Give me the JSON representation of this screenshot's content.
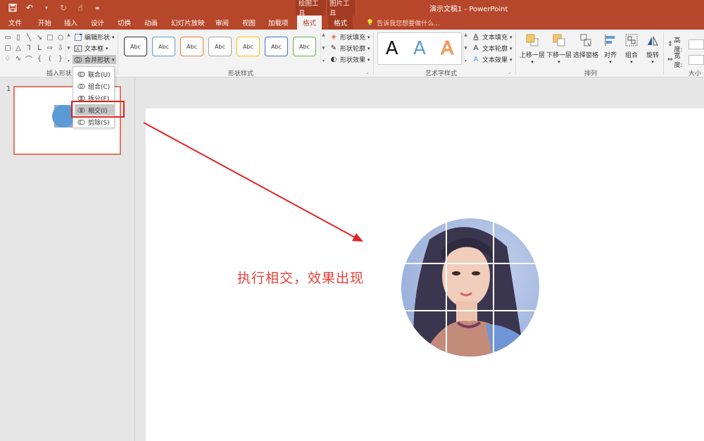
{
  "app": {
    "window_title": "演示文稿1 - PowerPoint",
    "context_groups": [
      "绘图工具",
      "图片工具"
    ]
  },
  "tabs": [
    {
      "label": "文件"
    },
    {
      "label": "开始"
    },
    {
      "label": "插入"
    },
    {
      "label": "设计"
    },
    {
      "label": "切换"
    },
    {
      "label": "动画"
    },
    {
      "label": "幻灯片放映"
    },
    {
      "label": "审阅"
    },
    {
      "label": "视图"
    },
    {
      "label": "加载项"
    },
    {
      "label": "格式"
    },
    {
      "label": "格式"
    }
  ],
  "tell_me": "告诉我您想要做什么...",
  "ribbon": {
    "insert_shapes": {
      "label": "插入形状",
      "edit_shape": "编辑形状",
      "text_box": "文本框",
      "merge_shapes": "合并形状"
    },
    "shape_styles": {
      "label": "形状样式",
      "presets": [
        "Abc",
        "Abc",
        "Abc",
        "Abc",
        "Abc",
        "Abc",
        "Abc"
      ],
      "preset_colors": [
        "#333333",
        "#5b9bd5",
        "#ed7d31",
        "#a5a5a5",
        "#ffc000",
        "#4472c4",
        "#70ad47"
      ],
      "fill": "形状填充",
      "outline": "形状轮廓",
      "effects": "形状效果"
    },
    "wordart": {
      "label": "艺术字样式",
      "samples": [
        "A",
        "A",
        "A"
      ],
      "text_fill": "文本填充",
      "text_outline": "文本轮廓",
      "text_effects": "文本效果"
    },
    "arrange": {
      "label": "排列",
      "bring_forward": "上移一层",
      "send_backward": "下移一层",
      "selection_pane": "选择窗格",
      "align": "对齐",
      "group": "组合",
      "rotate": "旋转"
    },
    "size": {
      "label": "大小",
      "height": "高度:",
      "width": "宽度:"
    }
  },
  "merge_menu": [
    {
      "label": "联合(U)"
    },
    {
      "label": "组合(C)"
    },
    {
      "label": "拆分(F)"
    },
    {
      "label": "相交(I)"
    },
    {
      "label": "剪除(S)"
    }
  ],
  "slide_pane": {
    "number": "1"
  },
  "slide": {
    "caption": "执行相交，效果出现"
  },
  "colors": {
    "accent": "#b7472a",
    "annotation_red": "#e02424"
  }
}
